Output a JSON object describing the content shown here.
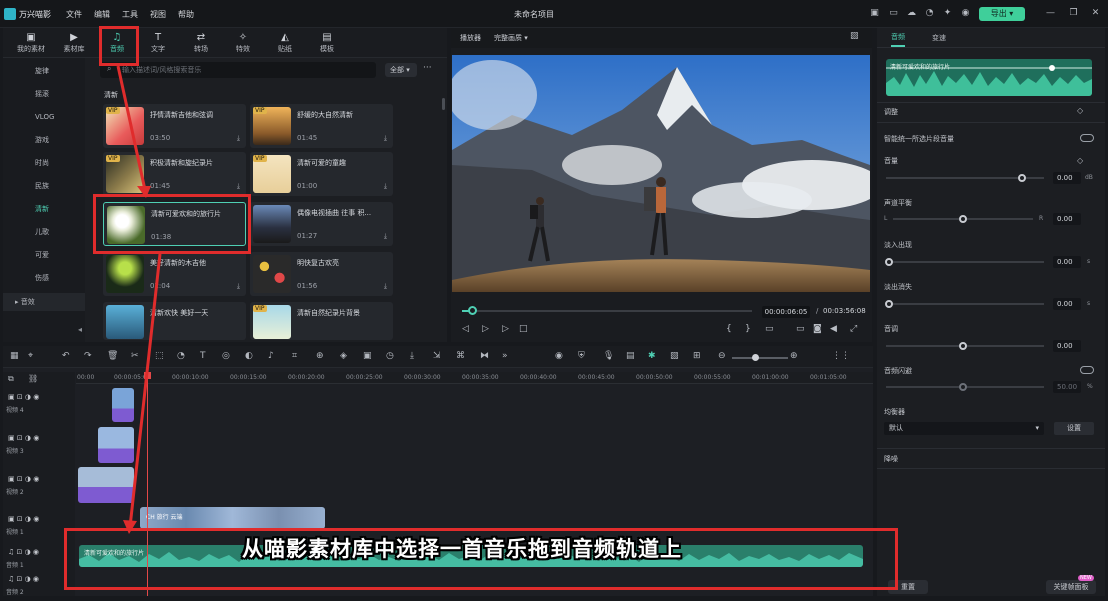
{
  "app": {
    "name": "万兴喵影",
    "project_title": "未命名项目",
    "menu": [
      "文件",
      "编辑",
      "工具",
      "视图",
      "帮助"
    ],
    "export_label": "导出"
  },
  "library": {
    "tabs": [
      "我的素材",
      "素材库",
      "音频",
      "文字",
      "转场",
      "特效",
      "贴纸",
      "模板"
    ],
    "categories": [
      "旋律",
      "摇滚",
      "VLOG",
      "游戏",
      "时尚",
      "民族",
      "清新",
      "儿歌",
      "可爱",
      "伤感",
      "音效"
    ],
    "active_category": "清新",
    "search_placeholder": "输入描述词/风格搜索音乐",
    "filter": "全部",
    "more": "···",
    "section_title": "清新",
    "cards": [
      {
        "title": "抒情清新吉他和弦调",
        "duration": "03:50",
        "vip": true
      },
      {
        "title": "舒缓的大自然清新",
        "duration": "01:45",
        "vip": true
      },
      {
        "title": "积极清新和旋纪录片",
        "duration": "01:45",
        "vip": true
      },
      {
        "title": "清新可爱的童趣",
        "duration": "01:00",
        "vip": true
      },
      {
        "title": "清新可爱欢和的旅行片",
        "duration": "01:38",
        "vip": false
      },
      {
        "title": "偶像电视插曲 往事 积...",
        "duration": "01:27",
        "vip": false
      },
      {
        "title": "美好清新的木吉他",
        "duration": "02:04",
        "vip": false
      },
      {
        "title": "明快复古欢亮",
        "duration": "01:56",
        "vip": false
      },
      {
        "title": "清新欢快 美好一天",
        "duration": "",
        "vip": false
      },
      {
        "title": "清新自然纪录片背景",
        "duration": "",
        "vip": true
      }
    ],
    "vip_badge": "VIP"
  },
  "player": {
    "label": "播放器",
    "quality": "完整画质",
    "current_time": "00:00:06:05",
    "total_time": "00:03:56:08",
    "progress": 0.03
  },
  "properties": {
    "tabs": [
      "音频",
      "变速"
    ],
    "clip_name": "清新可爱欢和的旅行片",
    "adjust_title": "调整",
    "auto_normalize": "智能统一所选片段音量",
    "volume_label": "音量",
    "volume_value": "0.00",
    "volume_unit": "dB",
    "balance_label": "声道平衡",
    "balance_l": "L",
    "balance_r": "R",
    "balance_value": "0.00",
    "fadein_label": "淡入出现",
    "fadein_value": "0.00",
    "fadeout_label": "淡出消失",
    "fadeout_value": "0.00",
    "pitch_label": "音调",
    "pitch_value": "0.00",
    "ducking_label": "音频闪避",
    "ducking_value": "50.00",
    "eq_label": "均衡器",
    "eq_value": "默认",
    "eq_button": "设置",
    "denoise_title": "降噪",
    "reset_button": "重置",
    "keyframe_button": "关键帧面板",
    "new_badge": "NEW",
    "unit_s": "s",
    "unit_pct": "%"
  },
  "timeline": {
    "ticks": [
      "00:00",
      "00:00:05:00",
      "00:00:10:00",
      "00:00:15:00",
      "00:00:20:00",
      "00:00:25:00",
      "00:00:30:00",
      "00:00:35:00",
      "00:00:40:00",
      "00:00:45:00",
      "00:00:50:00",
      "00:00:55:00",
      "00:01:00:00",
      "00:01:05:00"
    ],
    "tracks": [
      "视频 4",
      "视频 3",
      "视频 2",
      "视频 1",
      "音频 1",
      "音频 2"
    ],
    "audio_clip_label": "清新可爱欢和的旅行片",
    "video_clip_label": "CH 旅行 云端"
  },
  "overlay": {
    "subtitle": "从喵影素材库中选择一首音乐拖到音频轨道上"
  },
  "colors": {
    "accent": "#4fd0b4",
    "annotation": "#e02c2c",
    "audio_clip": "#2a7f6b",
    "video_clip": "#7e5bd1"
  }
}
